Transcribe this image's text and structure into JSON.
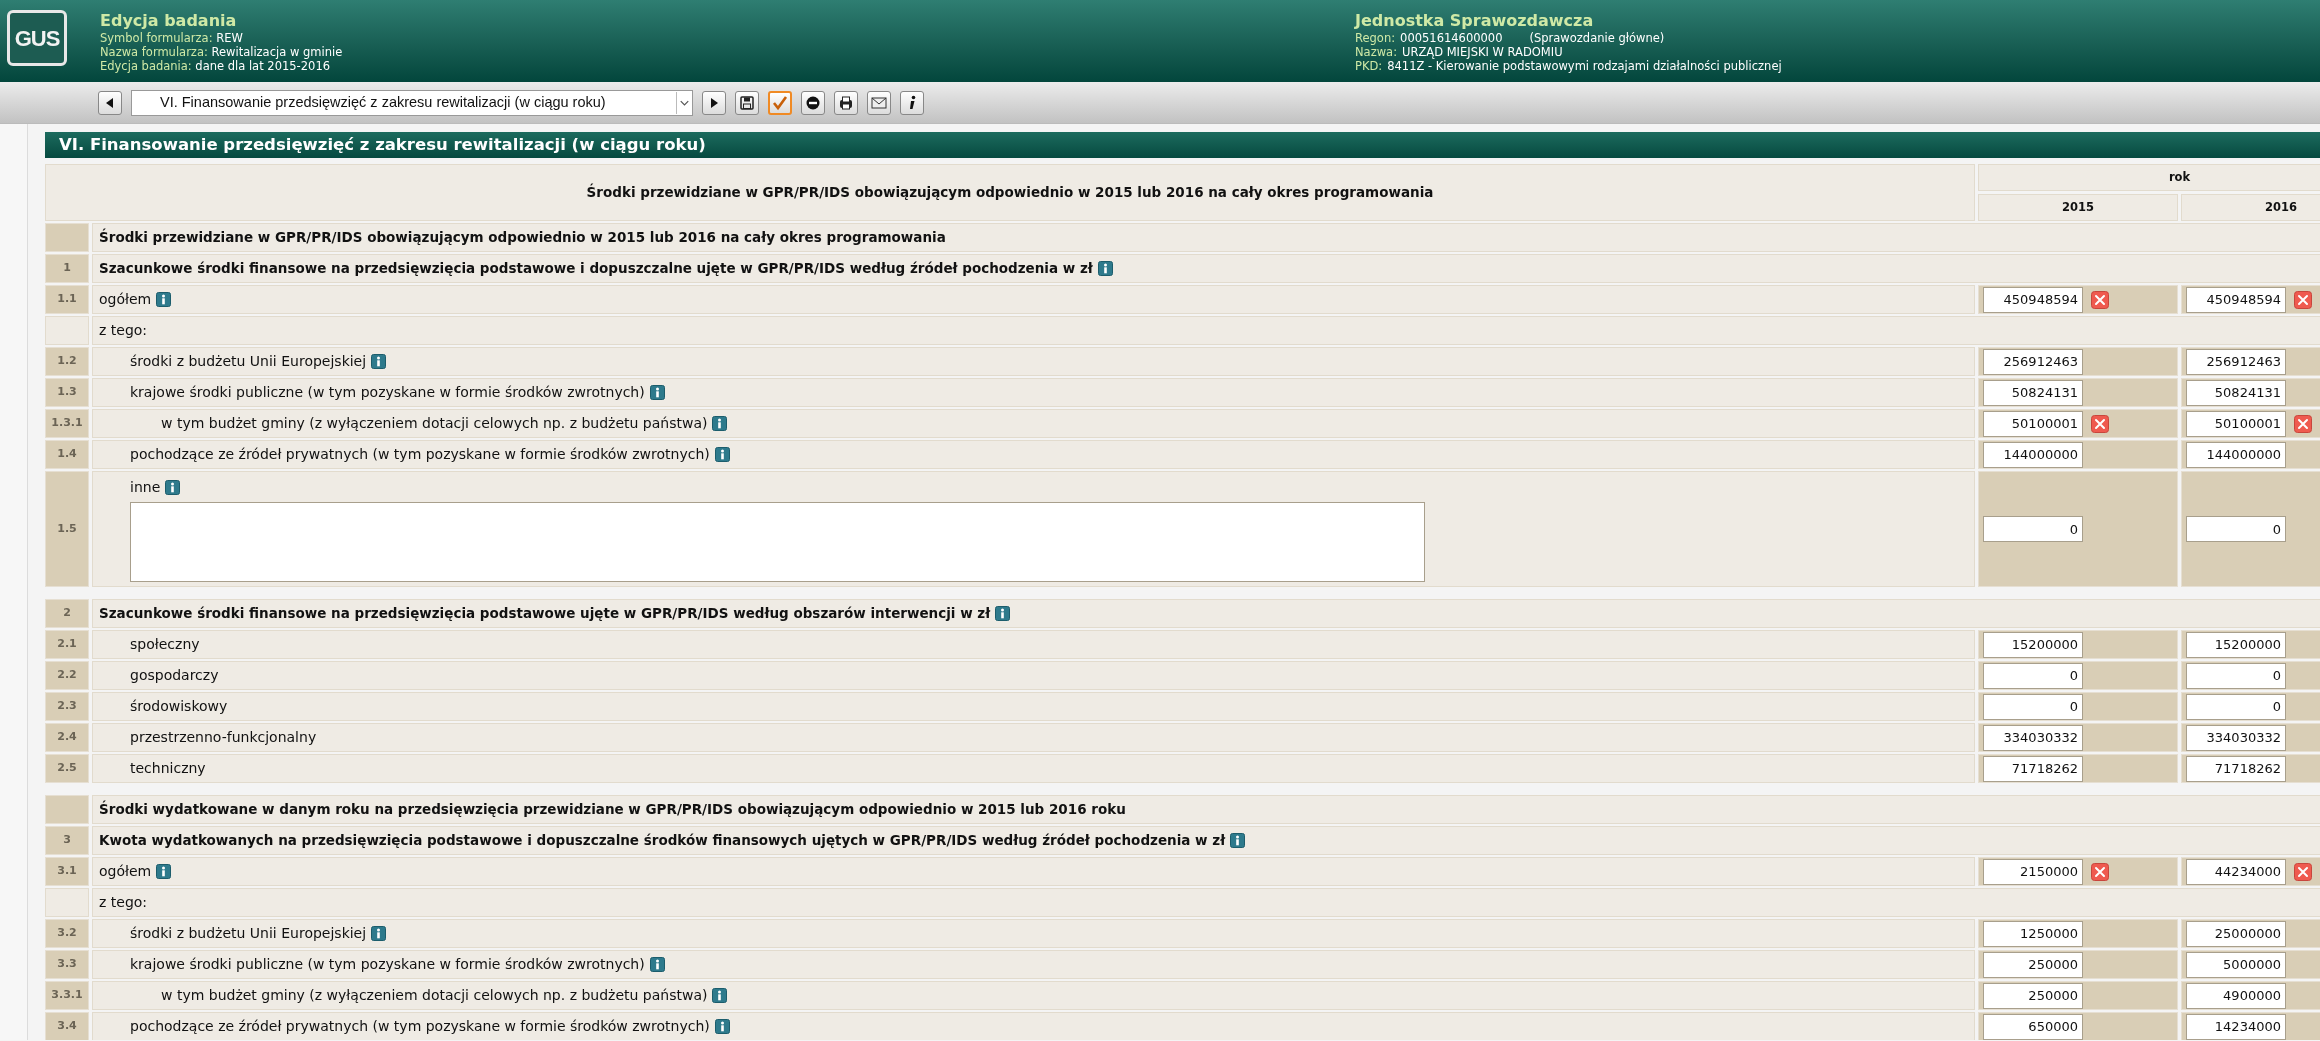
{
  "header": {
    "logo_text": "GUS",
    "title": "Edycja badania",
    "fields": [
      {
        "label": "Symbol formularza:",
        "value": "REW"
      },
      {
        "label": "Nazwa formularza:",
        "value": "Rewitalizacja w gminie"
      },
      {
        "label": "Edycja badania:",
        "value": "dane dla lat 2015-2016"
      }
    ]
  },
  "unit": {
    "title": "Jednostka Sprawozdawcza",
    "fields": [
      {
        "label": "Regon:",
        "value": "00051614600000",
        "note": "(Sprawozdanie główne)"
      },
      {
        "label": "Nazwa:",
        "value": "URZĄD MIEJSKI W RADOMIU"
      },
      {
        "label": "PKD:",
        "value": "8411Z - Kierowanie podstawowymi rodzajami działalności publicznej"
      }
    ]
  },
  "toolbar": {
    "section_select": "VI. Finansowanie przedsięwzięć z zakresu rewitalizacji (w ciągu roku)",
    "buttons": [
      {
        "kind": "next",
        "highlighted": false
      },
      {
        "kind": "save",
        "highlighted": false
      },
      {
        "kind": "check",
        "highlighted": true
      },
      {
        "kind": "stop",
        "highlighted": false
      },
      {
        "kind": "print",
        "highlighted": false
      },
      {
        "kind": "mail",
        "highlighted": false
      },
      {
        "kind": "info",
        "highlighted": false
      }
    ]
  },
  "section_title": "VI. Finansowanie przedsięwzięć z zakresu rewitalizacji (w ciągu roku)",
  "table": {
    "heading": "Środki przewidziane w GPR/PR/IDS obowiązującym odpowiednio w 2015 lub 2016 na cały okres programowania",
    "group": "rok",
    "years": [
      "2015",
      "2016"
    ],
    "blocks": [
      {
        "rows": [
          {
            "kind": "section",
            "label": "Środki przewidziane w GPR/PR/IDS obowiązującym odpowiednio w 2015 lub 2016 na cały okres programowania"
          },
          {
            "kind": "heading",
            "number": "1",
            "label": "Szacunkowe środki finansowe na przedsięwzięcia podstawowe i dopuszczalne ujęte w GPR/PR/IDS według źródeł pochodzenia w zł",
            "info": true
          },
          {
            "kind": "value",
            "number": "1.1",
            "label": "ogółem",
            "info": true,
            "values": [
              {
                "value": "450948594",
                "error": true
              },
              {
                "value": "450948594",
                "error": true
              }
            ]
          },
          {
            "kind": "label",
            "label": "z tego:",
            "children": [
              {
                "kind": "value",
                "number": "1.2",
                "label": "środki z budżetu Unii Europejskiej",
                "info": true,
                "values": [
                  {
                    "value": "256912463",
                    "error": false
                  },
                  {
                    "value": "256912463",
                    "error": false
                  }
                ]
              },
              {
                "kind": "value",
                "number": "1.3",
                "label": "krajowe środki publiczne (w tym pozyskane w formie środków zwrotnych)",
                "info": true,
                "values": [
                  {
                    "value": "50824131",
                    "error": false
                  },
                  {
                    "value": "50824131",
                    "error": false
                  }
                ],
                "children": [
                  {
                    "kind": "value",
                    "number": "1.3.1",
                    "label": "w tym budżet gminy (z wyłączeniem dotacji celowych np. z budżetu państwa)",
                    "info": true,
                    "values": [
                      {
                        "value": "50100001",
                        "error": true
                      },
                      {
                        "value": "50100001",
                        "error": true
                      }
                    ]
                  }
                ]
              },
              {
                "kind": "value",
                "number": "1.4",
                "label": "pochodzące ze źródeł prywatnych (w tym pozyskane w formie środków zwrotnych)",
                "info": true,
                "values": [
                  {
                    "value": "144000000",
                    "error": false
                  },
                  {
                    "value": "144000000",
                    "error": false
                  }
                ]
              },
              {
                "kind": "text",
                "number": "1.5",
                "label": "inne",
                "info": true,
                "values": [
                  {
                    "value": "0",
                    "error": false
                  },
                  {
                    "value": "0",
                    "error": false
                  }
                ]
              }
            ]
          }
        ]
      },
      {
        "rows": [
          {
            "kind": "heading",
            "number": "2",
            "label": "Szacunkowe środki finansowe na przedsięwzięcia podstawowe ujęte w GPR/PR/IDS według obszarów interwencji w zł",
            "info": true,
            "children": [
              {
                "kind": "value",
                "number": "2.1",
                "label": "społeczny",
                "info": false,
                "values": [
                  {
                    "value": "15200000",
                    "error": false
                  },
                  {
                    "value": "15200000",
                    "error": false
                  }
                ]
              },
              {
                "kind": "value",
                "number": "2.2",
                "label": "gospodarczy",
                "info": false,
                "values": [
                  {
                    "value": "0",
                    "error": false
                  },
                  {
                    "value": "0",
                    "error": false
                  }
                ]
              },
              {
                "kind": "value",
                "number": "2.3",
                "label": "środowiskowy",
                "info": false,
                "values": [
                  {
                    "value": "0",
                    "error": false
                  },
                  {
                    "value": "0",
                    "error": false
                  }
                ]
              },
              {
                "kind": "value",
                "number": "2.4",
                "label": "przestrzenno-funkcjonalny",
                "info": false,
                "values": [
                  {
                    "value": "334030332",
                    "error": false
                  },
                  {
                    "value": "334030332",
                    "error": false
                  }
                ]
              },
              {
                "kind": "value",
                "number": "2.5",
                "label": "techniczny",
                "info": false,
                "values": [
                  {
                    "value": "71718262",
                    "error": false
                  },
                  {
                    "value": "71718262",
                    "error": false
                  }
                ]
              }
            ]
          }
        ]
      },
      {
        "rows": [
          {
            "kind": "section",
            "label": "Środki wydatkowane w danym roku na przedsięwzięcia przewidziane w GPR/PR/IDS obowiązującym odpowiednio w 2015 lub 2016 roku"
          },
          {
            "kind": "heading",
            "number": "3",
            "label": "Kwota wydatkowanych na przedsięwzięcia podstawowe i dopuszczalne środków finansowych ujętych w GPR/PR/IDS według źródeł pochodzenia w zł",
            "info": true
          },
          {
            "kind": "value",
            "number": "3.1",
            "label": "ogółem",
            "info": true,
            "values": [
              {
                "value": "2150000",
                "error": true
              },
              {
                "value": "44234000",
                "error": true
              }
            ]
          },
          {
            "kind": "label",
            "label": "z tego:",
            "children": [
              {
                "kind": "value",
                "number": "3.2",
                "label": "środki z budżetu Unii Europejskiej",
                "info": true,
                "values": [
                  {
                    "value": "1250000",
                    "error": false
                  },
                  {
                    "value": "25000000",
                    "error": false
                  }
                ]
              },
              {
                "kind": "value",
                "number": "3.3",
                "label": "krajowe środki publiczne (w tym pozyskane w formie środków zwrotnych)",
                "info": true,
                "values": [
                  {
                    "value": "250000",
                    "error": false
                  },
                  {
                    "value": "5000000",
                    "error": false
                  }
                ],
                "children": [
                  {
                    "kind": "value",
                    "number": "3.3.1",
                    "label": "w tym budżet gminy (z wyłączeniem dotacji celowych np. z budżetu państwa)",
                    "info": true,
                    "values": [
                      {
                        "value": "250000",
                        "error": false
                      },
                      {
                        "value": "4900000",
                        "error": false
                      }
                    ]
                  }
                ]
              },
              {
                "kind": "value",
                "number": "3.4",
                "label": "pochodzące ze źródeł prywatnych (w tym pozyskane w formie środków zwrotnych)",
                "info": true,
                "values": [
                  {
                    "value": "650000",
                    "error": false
                  },
                  {
                    "value": "14234000",
                    "error": false
                  }
                ]
              }
            ]
          }
        ]
      }
    ]
  }
}
